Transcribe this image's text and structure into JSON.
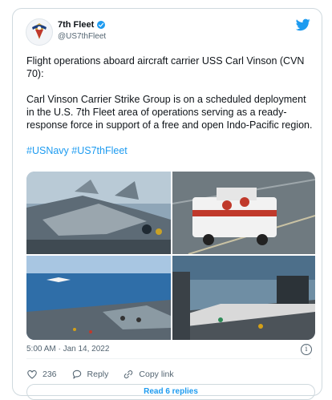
{
  "account": {
    "name": "7th Fleet",
    "handle": "@US7thFleet",
    "verified": true
  },
  "tweet": {
    "paragraphs": [
      "Flight operations aboard aircraft carrier USS Carl Vinson (CVN 70):",
      "Carl Vinson Carrier Strike Group is on a scheduled deployment in the U.S. 7th Fleet area of operations serving as a ready-response force in support of a free and open Indo-Pacific region."
    ],
    "hashtags": "#USNavy #US7thFleet",
    "timestamp": "5:00 AM · Jan 14, 2022"
  },
  "actions": {
    "likes": "236",
    "reply_label": "Reply",
    "copy_label": "Copy link"
  },
  "read_replies": "Read 6 replies",
  "icons": [
    "verified-badge-icon",
    "twitter-bird-icon",
    "info-icon",
    "heart-icon",
    "reply-icon",
    "link-icon"
  ],
  "colors": {
    "accent": "#1d9bf0",
    "muted": "#536471",
    "border": "#cfd9de"
  }
}
